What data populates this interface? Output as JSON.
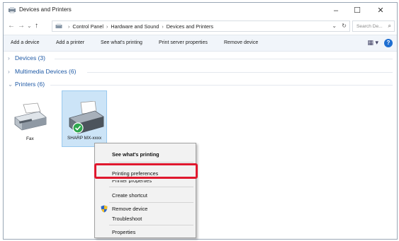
{
  "window": {
    "title": "Devices and Printers",
    "controls": {
      "minimize": "–",
      "maximize": "☐",
      "close": "✕"
    }
  },
  "addressbar": {
    "nav": {
      "back": "←",
      "forward": "→",
      "recent": "⌄",
      "up": "↑"
    },
    "breadcrumb": [
      "Control Panel",
      "Hardware and Sound",
      "Devices and Printers"
    ],
    "separator": "›",
    "dropdown": "⌄",
    "refresh": "↻",
    "search_placeholder": "Search De...",
    "search_icon": "⌕"
  },
  "toolbar": {
    "items": [
      "Add a device",
      "Add a printer",
      "See what's printing",
      "Print server properties",
      "Remove device"
    ],
    "view_icon": "▦ ▾",
    "help": "?"
  },
  "groups": [
    {
      "chevron": "›",
      "label": "Devices (3)",
      "expanded": false
    },
    {
      "chevron": "›",
      "label": "Multimedia Devices (6)",
      "expanded": false
    },
    {
      "chevron": "⌄",
      "label": "Printers (6)",
      "expanded": true
    }
  ],
  "printers": [
    {
      "label": "Fax",
      "icon": "fax-printer-icon"
    },
    {
      "label": "SHARP MX-xxxx",
      "icon": "printer-default-icon",
      "selected": true
    }
  ],
  "context_menu": {
    "items": [
      {
        "label": "See what's printing",
        "bold": true
      },
      {
        "label": "Printing preferences",
        "highlighted": true
      },
      {
        "label": "Printer properties",
        "partially_hidden": true
      },
      {
        "label": "Create shortcut"
      },
      {
        "label": "Remove device",
        "icon": "shield-icon"
      },
      {
        "label": "Troubleshoot"
      },
      {
        "label": "Properties"
      }
    ]
  },
  "colors": {
    "accent": "#1f5aa6",
    "highlight_box": "#e0182e",
    "selection": "#cce4f7"
  }
}
